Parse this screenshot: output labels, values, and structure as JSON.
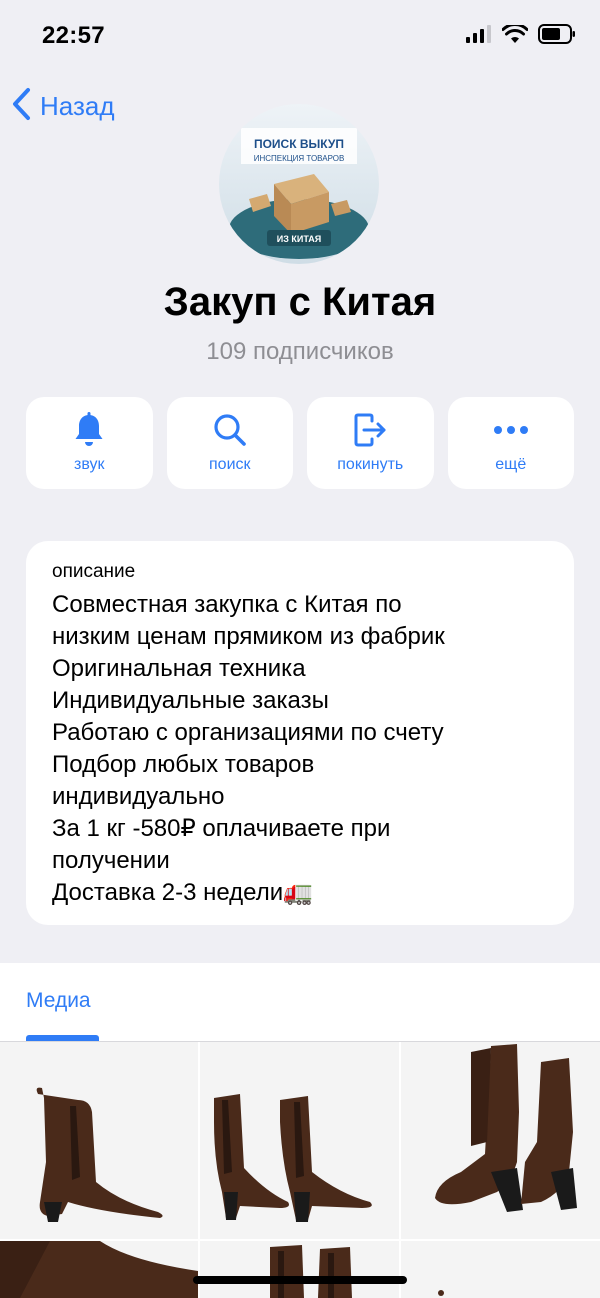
{
  "status_bar": {
    "time": "22:57",
    "icons": [
      "signal-icon",
      "wifi-icon",
      "battery-icon"
    ]
  },
  "nav": {
    "back_label": "Назад",
    "back_icon": "chevron-left-icon"
  },
  "channel": {
    "avatar_text_line1": "ПОИСК ВЫКУП",
    "avatar_text_line2": "ИНСПЕКЦИЯ ТОВАРОВ",
    "avatar_text_line3": "ИЗ КИТАЯ",
    "title": "Закуп с Китая",
    "subscribers": "109 подписчиков"
  },
  "actions": [
    {
      "label": "звук",
      "icon": "bell-icon"
    },
    {
      "label": "поиск",
      "icon": "search-icon"
    },
    {
      "label": "покинуть",
      "icon": "leave-icon"
    },
    {
      "label": "ещё",
      "icon": "more-icon"
    }
  ],
  "description": {
    "caption": "описание",
    "lines": [
      "Совместная закупка с Китая по",
      "низким ценам прямиком из фабрик",
      "Оригинальная техника",
      "Индивидуальные заказы",
      "Работаю с организациями по счету",
      "Подбор любых товаров",
      "индивидуально",
      "За 1 кг -580₽ оплачиваете при",
      "получении",
      "Доставка 2-3 недели🚛"
    ]
  },
  "media": {
    "tab_label": "Медиа",
    "items": [
      "boot-photo",
      "boot-pair-photo",
      "boot-pair-back-photo",
      "boot-photo",
      "boot-photo",
      "boot-photo"
    ]
  },
  "colors": {
    "accent": "#2f7cf6",
    "background": "#efeff4",
    "secondary_text": "#8e8e93",
    "boot_brown": "#4a2a1a"
  }
}
